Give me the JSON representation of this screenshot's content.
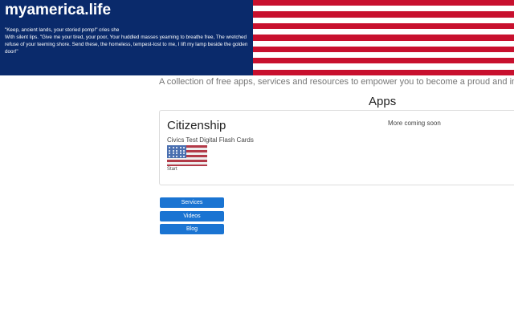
{
  "header": {
    "site_title": "myamerica.life",
    "poem_lines": [
      "\"Keep, ancient lands, your storied pomp!\" cries she",
      "With silent lips. \"Give me your tired, your poor, Your huddled masses yearning to breathe free, The wretched refuse of your teeming shore. Send these, the homeless, tempest-tost to me, I lift my lamp beside the golden door!\""
    ],
    "colors": {
      "canton": "#0a2a6b",
      "stripe_red": "#c8102e",
      "stripe_white": "#ffffff"
    }
  },
  "tagline": "A collection of free apps, services and resources to empower you to become a proud and informed US citizen",
  "apps": {
    "heading": "Apps",
    "section_title": "Citizenship",
    "items": [
      {
        "name": "Civics Test Digital Flash Cards",
        "thumb_icon": "american-flag-icon",
        "action_label": "Start"
      }
    ],
    "more_text": "More coming soon"
  },
  "nav_buttons": [
    {
      "label": "Services"
    },
    {
      "label": "Videos"
    },
    {
      "label": "Blog"
    }
  ]
}
